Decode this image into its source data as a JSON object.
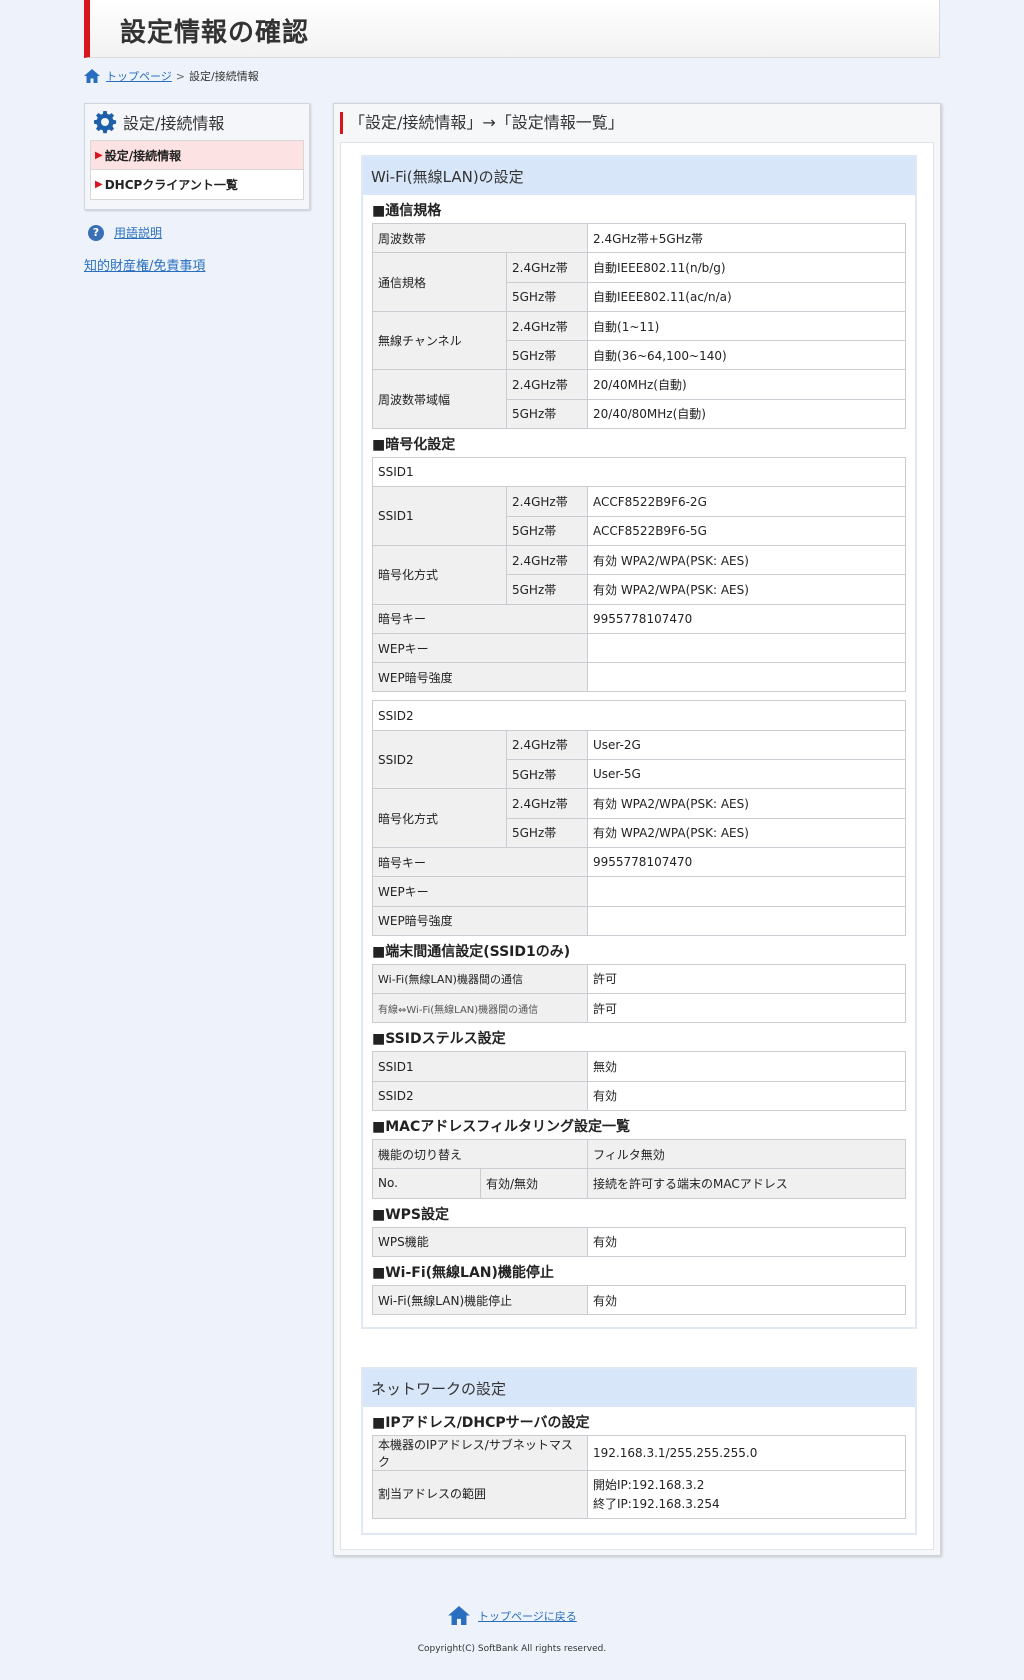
{
  "page_title": "設定情報の確認",
  "breadcrumb": {
    "home": "トップページ",
    "separator": ">",
    "current": "設定/接続情報"
  },
  "sidebar": {
    "title": "設定/接続情報",
    "items": [
      {
        "label": "設定/接続情報",
        "active": true
      },
      {
        "label": "DHCPクライアント一覧",
        "active": false
      }
    ],
    "help_label": "用語説明",
    "ip_label": "知的財産権/免責事項"
  },
  "main_title": "「設定/接続情報」→「設定情報一覧」",
  "wifi": {
    "heading": "Wi-Fi(無線LAN)の設定",
    "comm": {
      "heading": "■通信規格",
      "freq_label": "周波数帯",
      "freq_value": "2.4GHz帯+5GHz帯",
      "std_label": "通信規格",
      "std_24_band": "2.4GHz帯",
      "std_24_value": "自動IEEE802.11(n/b/g)",
      "std_5_band": "5GHz帯",
      "std_5_value": "自動IEEE802.11(ac/n/a)",
      "ch_label": "無線チャンネル",
      "ch_24_band": "2.4GHz帯",
      "ch_24_value": "自動(1~11)",
      "ch_5_band": "5GHz帯",
      "ch_5_value": "自動(36~64,100~140)",
      "bw_label": "周波数帯域幅",
      "bw_24_band": "2.4GHz帯",
      "bw_24_value": "20/40MHz(自動)",
      "bw_5_band": "5GHz帯",
      "bw_5_value": "20/40/80MHz(自動)"
    },
    "enc": {
      "heading": "■暗号化設定",
      "ssid1": {
        "title": "SSID1",
        "ssid_label": "SSID1",
        "b24": "2.4GHz帯",
        "ssid_24": "ACCF8522B9F6-2G",
        "b5": "5GHz帯",
        "ssid_5": "ACCF8522B9F6-5G",
        "enc_label": "暗号化方式",
        "enc_24": "有効 WPA2/WPA(PSK: AES)",
        "enc_5": "有効 WPA2/WPA(PSK: AES)",
        "key_label": "暗号キー",
        "key_value": "9955778107470",
        "wep_label": "WEPキー",
        "wep_value": "",
        "wepstr_label": "WEP暗号強度",
        "wepstr_value": ""
      },
      "ssid2": {
        "title": "SSID2",
        "ssid_label": "SSID2",
        "b24": "2.4GHz帯",
        "ssid_24": "User-2G",
        "b5": "5GHz帯",
        "ssid_5": "User-5G",
        "enc_label": "暗号化方式",
        "enc_24": "有効 WPA2/WPA(PSK: AES)",
        "enc_5": "有効 WPA2/WPA(PSK: AES)",
        "key_label": "暗号キー",
        "key_value": "9955778107470",
        "wep_label": "WEPキー",
        "wep_value": "",
        "wepstr_label": "WEP暗号強度",
        "wepstr_value": ""
      }
    },
    "inter": {
      "heading": "■端末間通信設定(SSID1のみ)",
      "row1_label": "Wi-Fi(無線LAN)機器間の通信",
      "row1_value": "許可",
      "row2_label": "有線⇔Wi-Fi(無線LAN)機器間の通信",
      "row2_value": "許可"
    },
    "stealth": {
      "heading": "■SSIDステルス設定",
      "row1_label": "SSID1",
      "row1_value": "無効",
      "row2_label": "SSID2",
      "row2_value": "有効"
    },
    "mac": {
      "heading": "■MACアドレスフィルタリング設定一覧",
      "switch_label": "機能の切り替え",
      "switch_value": "フィルタ無効",
      "col_no": "No.",
      "col_enable": "有効/無効",
      "col_mac": "接続を許可する端末のMACアドレス"
    },
    "wps": {
      "heading": "■WPS設定",
      "label": "WPS機能",
      "value": "有効"
    },
    "stop": {
      "heading": "■Wi-Fi(無線LAN)機能停止",
      "label": "Wi-Fi(無線LAN)機能停止",
      "value": "有効"
    }
  },
  "network": {
    "heading": "ネットワークの設定",
    "ip": {
      "heading": "■IPアドレス/DHCPサーバの設定",
      "addr_label": "本機器のIPアドレス/サブネットマスク",
      "addr_value": "192.168.3.1/255.255.255.0",
      "range_label": "割当アドレスの範囲",
      "range_start": "開始IP:192.168.3.2",
      "range_end": "終了IP:192.168.3.254"
    }
  },
  "footer": {
    "top_link": "トップページに戻る",
    "copyright": "Copyright(C) SoftBank All rights reserved."
  },
  "colors": {
    "accent": "#d8141c",
    "link": "#2a6fbf",
    "section_head": "#d7e6f8"
  }
}
